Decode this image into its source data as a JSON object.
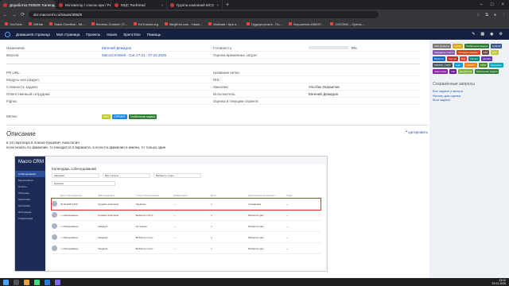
{
  "browser": {
    "tabs": [
      {
        "label": "Доработка #30829: Календар",
        "active": true
      },
      {
        "label": "Мотиватор / список ари / Ры",
        "active": false
      },
      {
        "label": "МЦС RedHead",
        "active": false
      },
      {
        "label": "Группа компаний МСS",
        "active": false
      }
    ],
    "url": "skz.macrocrm.ru/issues/30829",
    "bookmarks": [
      "YouTube",
      "GitHub",
      "Stack Overflow - Wi...",
      "Reverso Context | П...",
      "RuTracker.org",
      "MegEmil.com - Нижи...",
      "Motivate / Ари и ...",
      "Трудоустроить - По...",
      "Улучшения #36497...",
      "СХСОМС - Opimiz..."
    ]
  },
  "redmine": {
    "menu": [
      "Домашняя страница",
      "Моя страница",
      "Проекты",
      "Issues",
      "Spent time",
      "Помощь"
    ]
  },
  "issue": {
    "rows": [
      {
        "l1": "Назначена:",
        "v1": "Евгений Демидов",
        "l2": "Готовность:",
        "v2": "0%"
      },
      {
        "l1": "Версия:",
        "v1": "MacroCrmWeb - Сат 27.01 - 07.02.2025",
        "l2": "Оценка временных затрат:",
        "v2": ""
      },
      {
        "l1": "PR URL:",
        "v1": "",
        "l2": "Название ветки:",
        "v2": ""
      },
      {
        "l1": "Модуль или раздел:",
        "v1": "",
        "l2": "RIS:",
        "v2": ""
      },
      {
        "l1": "Сложность задачи:",
        "v1": "",
        "l2": "Заказчик:",
        "v2": "Ультбек Исмаилов"
      },
      {
        "l1": "Ответственный сотрудник:",
        "v1": "",
        "l2": "Исполнитель:",
        "v2": "Евгений Демидов"
      },
      {
        "l1": "Figma:",
        "v1": "",
        "l2": "Оценка в текущем спринте:",
        "v2": ""
      }
    ],
    "tags_label": "Метки:",
    "tags": [
      "Web",
      "СПРИНТ",
      "Глобальная задача"
    ],
    "description_title": "Описание",
    "quote_label": "Цитировать",
    "description_lines": [
      "в 1S партнера в поиске Кущевич Анастасия",
      "если искать по фамилии, то находится 2 варианта, а если по фамилии и имени, то только один"
    ]
  },
  "screenshot": {
    "title": "Календарь собеседований",
    "logo": "Macro CRM",
    "side_items": [
      "Собеседования",
      "Мероприятия",
      "Отчёты",
      "Обучение",
      "Аналитика",
      "Настройки",
      "Интеграции",
      "Справочники"
    ],
    "filter_placeholders": [
      "Кандидат",
      "Все статусы",
      "Выберите отдел"
    ],
    "search_value": "Кущевич",
    "headers": [
      "Дата собеседования",
      "ФИО кандидата",
      "Статус собеседования",
      "Комментарии",
      "Этап",
      "Дата выхода на обучение",
      "Отдел"
    ],
    "rows": [
      [
        "04.02.2025 13:00",
        "Кущевич Анастасия",
        "Одобрено",
        "—",
        "1",
        "Стажировка",
        "—"
      ],
      [
        "+ собеседование",
        "Кущевич Анастасия",
        "Выберите статус",
        "—",
        "1",
        "Выберите дату",
        "—"
      ],
      [
        "+ собеседование",
        "Кандидат",
        "Не пришёл",
        "—",
        "1",
        "Выберите дату",
        "—"
      ],
      [
        "+ собеседование",
        "Кандидат",
        "Выберите статус",
        "—",
        "1",
        "Выберите дату",
        "—"
      ],
      [
        "+ собеседование",
        "Кандидат",
        "Выберите статус",
        "—",
        "1",
        "Выберите дату",
        "—"
      ]
    ]
  },
  "sidebar": {
    "tags": [
      {
        "t": "Мой профиль",
        "c": "#7a7a7a"
      },
      {
        "t": "mobile",
        "c": "#e0a800"
      },
      {
        "t": "Глобальная задача",
        "c": "#2e7d32"
      },
      {
        "t": "Android",
        "c": "#3b5998"
      },
      {
        "t": "Ожидание ответа",
        "c": "#8a56ac"
      },
      {
        "t": "Снимаем (сервис)",
        "c": "#d84315"
      },
      {
        "t": "iOS",
        "c": "#6d4c41"
      },
      {
        "t": "Web",
        "c": "#c0ca33"
      },
      {
        "t": "Backend",
        "c": "#1565c0"
      },
      {
        "t": "Срочно",
        "c": "#c62828"
      },
      {
        "t": "Bug",
        "c": "#e53935"
      },
      {
        "t": "Проект",
        "c": "#00897b"
      },
      {
        "t": "Дизайн",
        "c": "#5e35b1"
      },
      {
        "t": "PROMO_TEST",
        "c": "#455a64"
      },
      {
        "t": "Сайт",
        "c": "#039be5"
      },
      {
        "t": "СПРИНТ",
        "c": "#f57c00"
      },
      {
        "t": "CRM",
        "c": "#558b2f"
      },
      {
        "t": "Обучение",
        "c": "#00acc1"
      },
      {
        "t": "Аналитика",
        "c": "#8e24aa"
      },
      {
        "t": "Ulta",
        "c": "#6a1b9a"
      },
      {
        "t": "Доработка",
        "c": "#7cb342"
      },
      {
        "t": "Мобильная задача",
        "c": "#2e7d32"
      }
    ],
    "saved_title": "Сохранённые запросы",
    "saved_links": [
      "Все задачи у автора",
      "Фильтр для оценки",
      "Мои задачи"
    ]
  },
  "taskbar": {
    "time": "23:11",
    "date": "23.01.2025"
  }
}
